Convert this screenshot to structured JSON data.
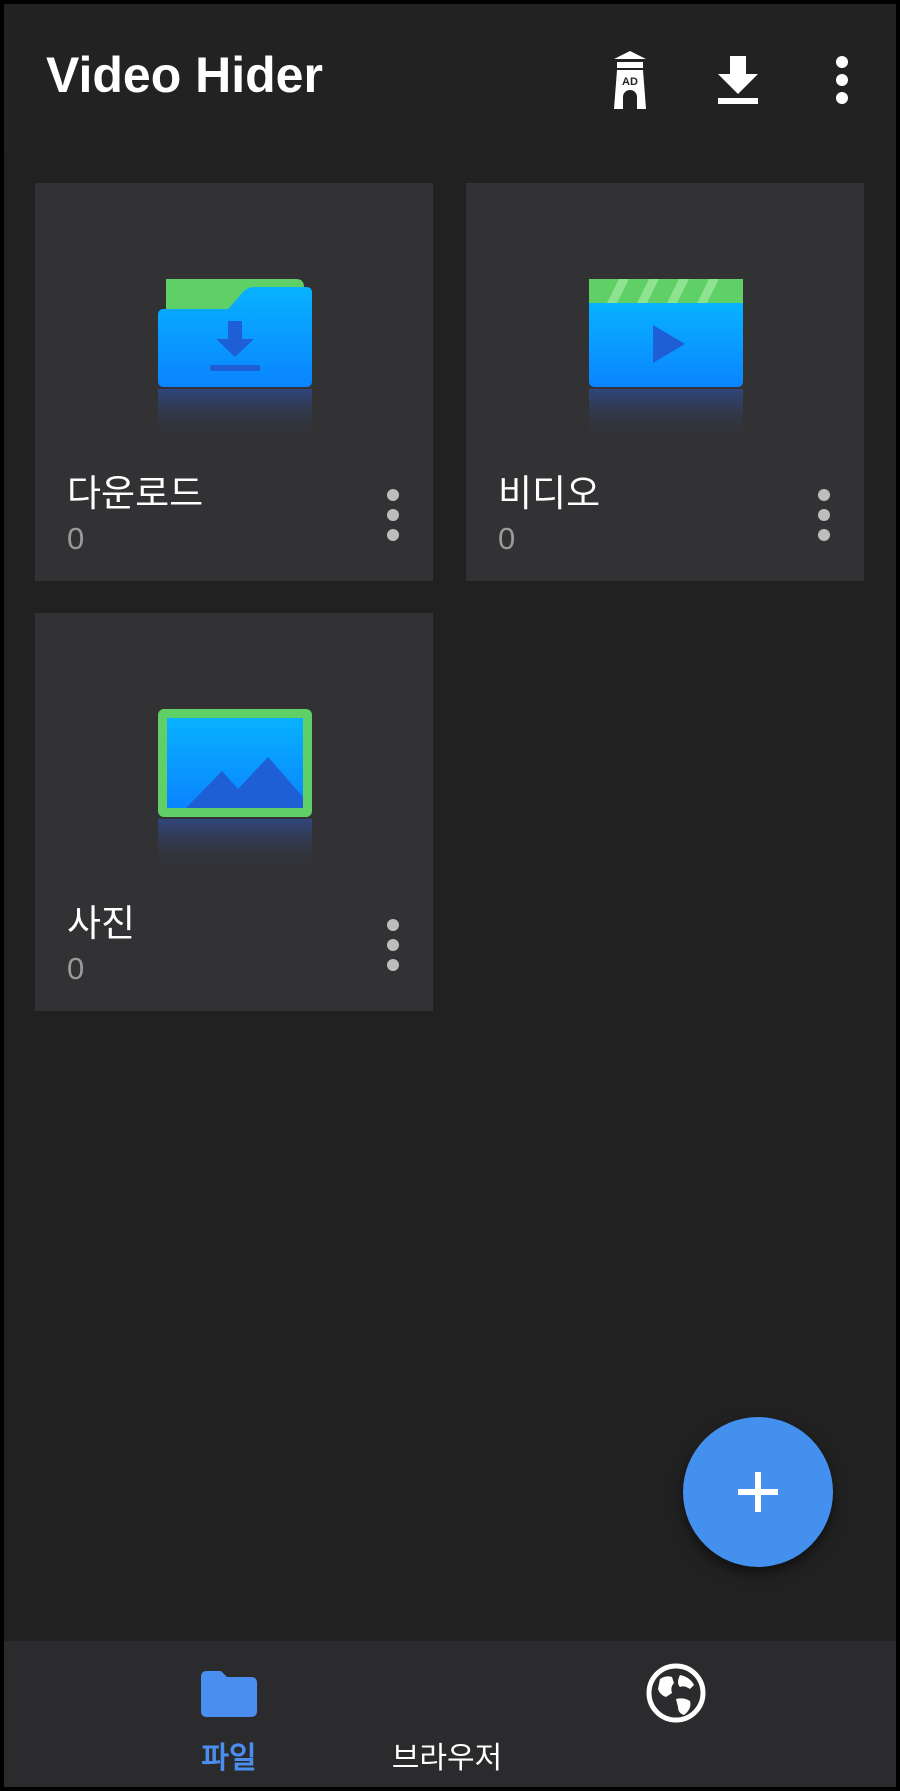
{
  "app": {
    "title": "Video Hider"
  },
  "appbar": {
    "ad_icon_text": "AD"
  },
  "folders": [
    {
      "name": "다운로드",
      "count": "0",
      "icon": "download-folder-icon"
    },
    {
      "name": "비디오",
      "count": "0",
      "icon": "video-folder-icon"
    },
    {
      "name": "사진",
      "count": "0",
      "icon": "photo-folder-icon"
    }
  ],
  "bottom_nav": {
    "items": [
      {
        "label": "파일",
        "icon": "folder-icon",
        "active": true
      },
      {
        "label": "브라우저",
        "icon": "globe-icon",
        "active": false
      }
    ]
  },
  "colors": {
    "background": "#212121",
    "card": "#323234",
    "accent": "#4a8ff0",
    "fab": "#4390ef"
  }
}
